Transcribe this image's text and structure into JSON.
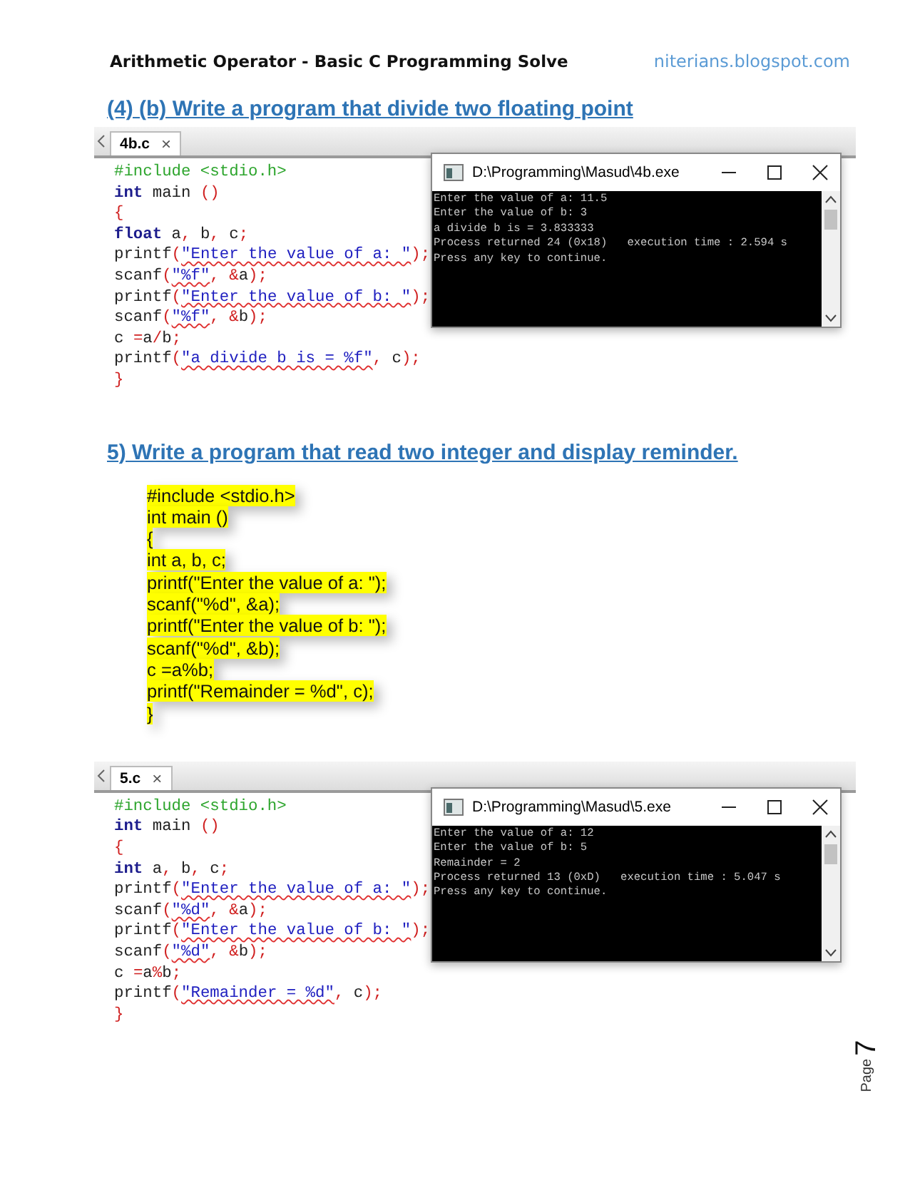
{
  "header": {
    "title": "Arithmetic Operator - Basic C Programming Solve",
    "site": "niterians.blogspot.com"
  },
  "sections": [
    {
      "kind": "editor",
      "heading": "(4) (b) Write a program that divide two floating point",
      "tab": "4b.c",
      "tab_close": "×",
      "code": [
        [
          {
            "kind": "pre",
            "text": "#include <stdio.h>"
          }
        ],
        [
          {
            "kind": "kw",
            "text": "int"
          },
          {
            "kind": "id",
            "text": " main "
          },
          {
            "kind": "op",
            "text": "()"
          }
        ],
        [
          {
            "kind": "op",
            "text": "{"
          }
        ],
        [
          {
            "kind": "kw",
            "text": "float"
          },
          {
            "kind": "id",
            "text": " a"
          },
          {
            "kind": "op",
            "text": ","
          },
          {
            "kind": "id",
            "text": " b"
          },
          {
            "kind": "op",
            "text": ","
          },
          {
            "kind": "id",
            "text": " c"
          },
          {
            "kind": "op",
            "text": ";"
          }
        ],
        [
          {
            "kind": "id",
            "text": "printf"
          },
          {
            "kind": "op",
            "text": "("
          },
          {
            "kind": "str",
            "text": "\"Enter the value of a: \""
          },
          {
            "kind": "op",
            "text": ");"
          }
        ],
        [
          {
            "kind": "id",
            "text": "scanf"
          },
          {
            "kind": "op",
            "text": "("
          },
          {
            "kind": "str",
            "text": "\"%f\""
          },
          {
            "kind": "op",
            "text": ", &"
          },
          {
            "kind": "id",
            "text": "a"
          },
          {
            "kind": "op",
            "text": ");"
          }
        ],
        [
          {
            "kind": "id",
            "text": "printf"
          },
          {
            "kind": "op",
            "text": "("
          },
          {
            "kind": "str",
            "text": "\"Enter the value of b: \""
          },
          {
            "kind": "op",
            "text": ");"
          }
        ],
        [
          {
            "kind": "id",
            "text": "scanf"
          },
          {
            "kind": "op",
            "text": "("
          },
          {
            "kind": "str",
            "text": "\"%f\""
          },
          {
            "kind": "op",
            "text": ", &"
          },
          {
            "kind": "id",
            "text": "b"
          },
          {
            "kind": "op",
            "text": ");"
          }
        ],
        [
          {
            "kind": "id",
            "text": "c "
          },
          {
            "kind": "op",
            "text": "="
          },
          {
            "kind": "id",
            "text": "a"
          },
          {
            "kind": "op",
            "text": "/"
          },
          {
            "kind": "id",
            "text": "b"
          },
          {
            "kind": "op",
            "text": ";"
          }
        ],
        [
          {
            "kind": "id",
            "text": "printf"
          },
          {
            "kind": "op",
            "text": "("
          },
          {
            "kind": "str",
            "text": "\"a divide b is = %f\""
          },
          {
            "kind": "op",
            "text": ","
          },
          {
            "kind": "id",
            "text": " c"
          },
          {
            "kind": "op",
            "text": ");"
          }
        ],
        [
          {
            "kind": "op",
            "text": "}"
          }
        ]
      ],
      "console": {
        "title": "D:\\Programming\\Masud\\4b.exe",
        "lines": [
          "Enter the value of a: 11.5",
          "Enter the value of b: 3",
          "a divide b is = 3.833333",
          "Process returned 24 (0x18)   execution time : 2.594 s",
          "Press any key to continue."
        ]
      }
    },
    {
      "kind": "highlight",
      "heading": "5) Write a program that read two integer and display reminder.",
      "lines": [
        "#include <stdio.h>",
        "int main ()",
        "{",
        "int a, b, c;",
        "printf(\"Enter the value of a: \");",
        "scanf(\"%d\", &a);",
        "printf(\"Enter the value of b: \");",
        "scanf(\"%d\", &b);",
        "c =a%b;",
        "printf(\"Remainder = %d\", c);",
        "}"
      ]
    },
    {
      "kind": "editor",
      "tab": "5.c",
      "tab_close": "×",
      "code": [
        [
          {
            "kind": "pre",
            "text": "#include <stdio.h>"
          }
        ],
        [
          {
            "kind": "kw",
            "text": "int"
          },
          {
            "kind": "id",
            "text": " main "
          },
          {
            "kind": "op",
            "text": "()"
          }
        ],
        [
          {
            "kind": "op",
            "text": "{"
          }
        ],
        [
          {
            "kind": "kw",
            "text": "int"
          },
          {
            "kind": "id",
            "text": " a"
          },
          {
            "kind": "op",
            "text": ","
          },
          {
            "kind": "id",
            "text": " b"
          },
          {
            "kind": "op",
            "text": ","
          },
          {
            "kind": "id",
            "text": " c"
          },
          {
            "kind": "op",
            "text": ";"
          }
        ],
        [
          {
            "kind": "id",
            "text": "printf"
          },
          {
            "kind": "op",
            "text": "("
          },
          {
            "kind": "str",
            "text": "\"Enter the value of a: \""
          },
          {
            "kind": "op",
            "text": ");"
          }
        ],
        [
          {
            "kind": "id",
            "text": "scanf"
          },
          {
            "kind": "op",
            "text": "("
          },
          {
            "kind": "str",
            "text": "\"%d\""
          },
          {
            "kind": "op",
            "text": ", &"
          },
          {
            "kind": "id",
            "text": "a"
          },
          {
            "kind": "op",
            "text": ");"
          }
        ],
        [
          {
            "kind": "id",
            "text": "printf"
          },
          {
            "kind": "op",
            "text": "("
          },
          {
            "kind": "str",
            "text": "\"Enter the value of b: \""
          },
          {
            "kind": "op",
            "text": ");"
          }
        ],
        [
          {
            "kind": "id",
            "text": "scanf"
          },
          {
            "kind": "op",
            "text": "("
          },
          {
            "kind": "str",
            "text": "\"%d\""
          },
          {
            "kind": "op",
            "text": ", &"
          },
          {
            "kind": "id",
            "text": "b"
          },
          {
            "kind": "op",
            "text": ");"
          }
        ],
        [
          {
            "kind": "id",
            "text": "c "
          },
          {
            "kind": "op",
            "text": "="
          },
          {
            "kind": "id",
            "text": "a"
          },
          {
            "kind": "op",
            "text": "%"
          },
          {
            "kind": "id",
            "text": "b"
          },
          {
            "kind": "op",
            "text": ";"
          }
        ],
        [
          {
            "kind": "id",
            "text": "printf"
          },
          {
            "kind": "op",
            "text": "("
          },
          {
            "kind": "str",
            "text": "\"Remainder = %d\""
          },
          {
            "kind": "op",
            "text": ","
          },
          {
            "kind": "id",
            "text": " c"
          },
          {
            "kind": "op",
            "text": ");"
          }
        ],
        [
          {
            "kind": "op",
            "text": "}"
          }
        ]
      ],
      "console": {
        "title": "D:\\Programming\\Masud\\5.exe",
        "lines": [
          "Enter the value of a: 12",
          "Enter the value of b: 5",
          "Remainder = 2",
          "Process returned 13 (0xD)   execution time : 5.047 s",
          "Press any key to continue."
        ]
      }
    }
  ],
  "footer": {
    "label": "Page",
    "number": "7"
  }
}
